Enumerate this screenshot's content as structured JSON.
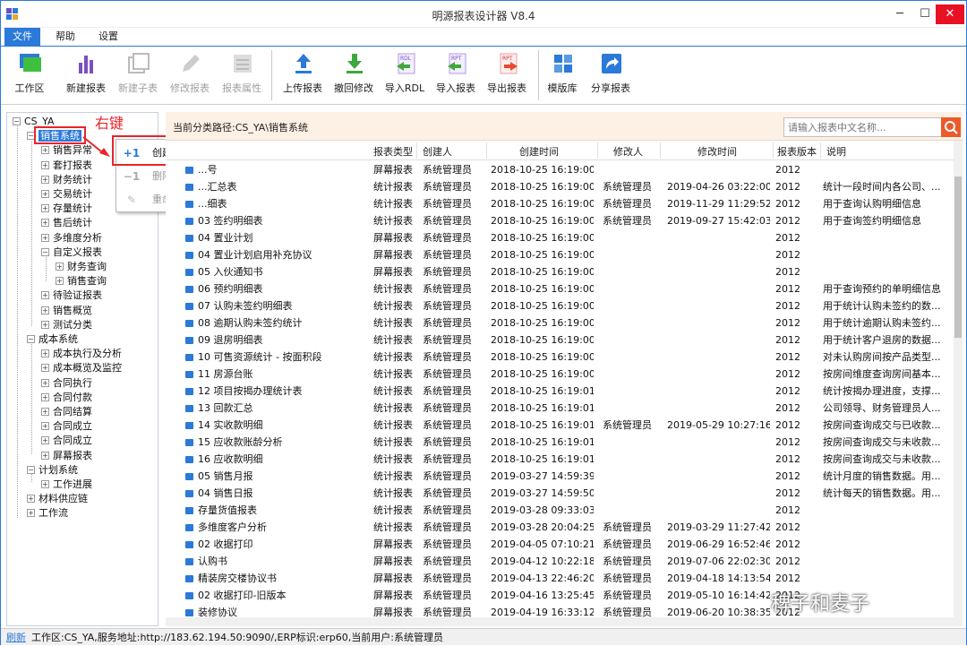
{
  "window": {
    "title": "明源报表设计器 V8.4",
    "minimize": "─",
    "maximize": "☐",
    "close": "✕"
  },
  "menu": [
    "文件",
    "帮助",
    "设置"
  ],
  "toolbar": [
    {
      "label": "工作区",
      "icon": "workspace-icon",
      "enabled": true
    },
    {
      "label": "新建报表",
      "icon": "bar-chart-icon",
      "enabled": true
    },
    {
      "label": "新建子表",
      "icon": "sub-table-icon",
      "enabled": false
    },
    {
      "label": "修改报表",
      "icon": "pencil-icon",
      "enabled": false
    },
    {
      "label": "报表属性",
      "icon": "properties-icon",
      "enabled": false
    },
    {
      "label": "上传报表",
      "icon": "upload-icon",
      "enabled": true
    },
    {
      "label": "撤回修改",
      "icon": "download-icon",
      "enabled": true
    },
    {
      "label": "导入RDL",
      "icon": "import-rdl-icon",
      "enabled": true
    },
    {
      "label": "导入报表",
      "icon": "import-rpt-icon",
      "enabled": true
    },
    {
      "label": "导出报表",
      "icon": "export-rpt-icon",
      "enabled": true
    },
    {
      "label": "模版库",
      "icon": "template-icon",
      "enabled": true
    },
    {
      "label": "分享报表",
      "icon": "share-icon",
      "enabled": true
    }
  ],
  "annotation": {
    "label": "右键"
  },
  "tree": [
    {
      "label": "CS_YA",
      "level": 0,
      "expanded": true
    },
    {
      "label": "销售系统",
      "level": 1,
      "expanded": true,
      "selected": true
    },
    {
      "label": "销售异常",
      "level": 2
    },
    {
      "label": "套打报表",
      "level": 2
    },
    {
      "label": "财务统计",
      "level": 2
    },
    {
      "label": "交易统计",
      "level": 2
    },
    {
      "label": "存量统计",
      "level": 2
    },
    {
      "label": "售后统计",
      "level": 2
    },
    {
      "label": "多维度分析",
      "level": 2
    },
    {
      "label": "自定义报表",
      "level": 2,
      "expanded": true
    },
    {
      "label": "财务查询",
      "level": 3
    },
    {
      "label": "销售查询",
      "level": 3
    },
    {
      "label": "待验证报表",
      "level": 2
    },
    {
      "label": "销售概览",
      "level": 2
    },
    {
      "label": "测试分类",
      "level": 2
    },
    {
      "label": "成本系统",
      "level": 1,
      "expanded": true
    },
    {
      "label": "成本执行及分析",
      "level": 2
    },
    {
      "label": "成本概览及监控",
      "level": 2
    },
    {
      "label": "合同执行",
      "level": 2
    },
    {
      "label": "合同付款",
      "level": 2
    },
    {
      "label": "合同结算",
      "level": 2
    },
    {
      "label": "合同成立",
      "level": 2
    },
    {
      "label": "合同成立",
      "level": 2
    },
    {
      "label": "屏幕报表",
      "level": 2
    },
    {
      "label": "计划系统",
      "level": 1,
      "expanded": true
    },
    {
      "label": "工作进展",
      "level": 2
    },
    {
      "label": "材料供应链",
      "level": 1
    },
    {
      "label": "工作流",
      "level": 1
    }
  ],
  "context_menu": [
    {
      "label": "创建分类(A)",
      "icon": "+1",
      "enabled": true
    },
    {
      "label": "删除分类(D)",
      "icon": "−1",
      "enabled": false
    },
    {
      "label": "重命名(R)",
      "icon": "✎",
      "enabled": false
    }
  ],
  "main": {
    "path": "当前分类路径:CS_YA\\销售系统",
    "search_placeholder": "请输入报表中文名称...",
    "columns": [
      "报表类型",
      "创建人",
      "创建时间",
      "修改人",
      "修改时间",
      "报表版本",
      "说明"
    ],
    "rows": [
      {
        "name": "...号",
        "type": "屏幕报表",
        "creator": "系统管理员",
        "created": "2018-10-25 16:19:00",
        "modifier": "",
        "modified": "",
        "version": "2012",
        "desc": ""
      },
      {
        "name": "...汇总表",
        "type": "统计报表",
        "creator": "系统管理员",
        "created": "2018-10-25 16:19:00",
        "modifier": "系统管理员",
        "modified": "2019-04-26 03:22:00",
        "version": "2012",
        "desc": "统计一段时间内各公司、..."
      },
      {
        "name": "...细表",
        "type": "统计报表",
        "creator": "系统管理员",
        "created": "2018-10-25 16:19:00",
        "modifier": "系统管理员",
        "modified": "2019-11-29 11:29:52",
        "version": "2012",
        "desc": "用于查询认购明细信息"
      },
      {
        "name": "03 签约明细表",
        "type": "统计报表",
        "creator": "系统管理员",
        "created": "2018-10-25 16:19:00",
        "modifier": "系统管理员",
        "modified": "2019-09-27 15:42:03",
        "version": "2012",
        "desc": "用于查询签约明细信息"
      },
      {
        "name": "04 置业计划",
        "type": "屏幕报表",
        "creator": "系统管理员",
        "created": "2018-10-25 16:19:00",
        "modifier": "",
        "modified": "",
        "version": "2012",
        "desc": ""
      },
      {
        "name": "04 置业计划启用补充协议",
        "type": "屏幕报表",
        "creator": "系统管理员",
        "created": "2018-10-25 16:19:00",
        "modifier": "",
        "modified": "",
        "version": "2012",
        "desc": ""
      },
      {
        "name": "05 入伙通知书",
        "type": "屏幕报表",
        "creator": "系统管理员",
        "created": "2018-10-25 16:19:00",
        "modifier": "",
        "modified": "",
        "version": "2012",
        "desc": ""
      },
      {
        "name": "06 预约明细表",
        "type": "统计报表",
        "creator": "系统管理员",
        "created": "2018-10-25 16:19:00",
        "modifier": "",
        "modified": "",
        "version": "2012",
        "desc": "用于查询预约的单明细信息"
      },
      {
        "name": "07 认购未签约明细表",
        "type": "统计报表",
        "creator": "系统管理员",
        "created": "2018-10-25 16:19:00",
        "modifier": "",
        "modified": "",
        "version": "2012",
        "desc": "用于统计认购未签约的数..."
      },
      {
        "name": "08 逾期认购未签约统计",
        "type": "统计报表",
        "creator": "系统管理员",
        "created": "2018-10-25 16:19:00",
        "modifier": "",
        "modified": "",
        "version": "2012",
        "desc": "用于统计逾期认购未签约..."
      },
      {
        "name": "09 退房明细表",
        "type": "统计报表",
        "creator": "系统管理员",
        "created": "2018-10-25 16:19:00",
        "modifier": "",
        "modified": "",
        "version": "2012",
        "desc": "用于统计客户退房的数据..."
      },
      {
        "name": "10 可售资源统计 - 按面积段",
        "type": "统计报表",
        "creator": "系统管理员",
        "created": "2018-10-25 16:19:00",
        "modifier": "",
        "modified": "",
        "version": "2012",
        "desc": "对未认购房间按产品类型..."
      },
      {
        "name": "11 房源台账",
        "type": "统计报表",
        "creator": "系统管理员",
        "created": "2018-10-25 16:19:00",
        "modifier": "",
        "modified": "",
        "version": "2012",
        "desc": "按房间维度查询房间基本..."
      },
      {
        "name": "12 项目按揭办理统计表",
        "type": "统计报表",
        "creator": "系统管理员",
        "created": "2018-10-25 16:19:01",
        "modifier": "",
        "modified": "",
        "version": "2012",
        "desc": "统计按揭办理进度，支撑..."
      },
      {
        "name": "13 回款汇总",
        "type": "统计报表",
        "creator": "系统管理员",
        "created": "2018-10-25 16:19:01",
        "modifier": "",
        "modified": "",
        "version": "2012",
        "desc": "公司领导、财务管理员人..."
      },
      {
        "name": "14 实收款明细",
        "type": "统计报表",
        "creator": "系统管理员",
        "created": "2018-10-25 16:19:01",
        "modifier": "系统管理员",
        "modified": "2019-05-29 10:27:16",
        "version": "2012",
        "desc": "按房间查询成交与已收款..."
      },
      {
        "name": "15 应收款账龄分析",
        "type": "统计报表",
        "creator": "系统管理员",
        "created": "2018-10-25 16:19:01",
        "modifier": "",
        "modified": "",
        "version": "2012",
        "desc": "按房间查询成交与未收款..."
      },
      {
        "name": "16 应收款明细",
        "type": "统计报表",
        "creator": "系统管理员",
        "created": "2018-10-25 16:19:01",
        "modifier": "",
        "modified": "",
        "version": "2012",
        "desc": "按房间查询成交与未收款..."
      },
      {
        "name": "05 销售月报",
        "type": "统计报表",
        "creator": "系统管理员",
        "created": "2019-03-27 14:59:39",
        "modifier": "",
        "modified": "",
        "version": "2012",
        "desc": "统计月度的销售数据。用..."
      },
      {
        "name": "04 销售日报",
        "type": "统计报表",
        "creator": "系统管理员",
        "created": "2019-03-27 14:59:50",
        "modifier": "",
        "modified": "",
        "version": "2012",
        "desc": "统计每天的销售数据。用..."
      },
      {
        "name": "存量货值报表",
        "type": "统计报表",
        "creator": "系统管理员",
        "created": "2019-03-28 09:33:03",
        "modifier": "",
        "modified": "",
        "version": "2012",
        "desc": ""
      },
      {
        "name": "多维度客户分析",
        "type": "统计报表",
        "creator": "系统管理员",
        "created": "2019-03-28 20:04:25",
        "modifier": "系统管理员",
        "modified": "2019-03-29 11:27:42",
        "version": "2012",
        "desc": ""
      },
      {
        "name": "02 收据打印",
        "type": "屏幕报表",
        "creator": "系统管理员",
        "created": "2019-04-05 07:10:21",
        "modifier": "系统管理员",
        "modified": "2019-06-29 16:52:46",
        "version": "2012",
        "desc": ""
      },
      {
        "name": "认购书",
        "type": "屏幕报表",
        "creator": "系统管理员",
        "created": "2019-04-12 10:22:18",
        "modifier": "系统管理员",
        "modified": "2019-07-06 22:02:30",
        "version": "2012",
        "desc": ""
      },
      {
        "name": "精装房交楼协议书",
        "type": "屏幕报表",
        "creator": "系统管理员",
        "created": "2019-04-13 22:46:20",
        "modifier": "系统管理员",
        "modified": "2019-04-18 14:13:54",
        "version": "2012",
        "desc": ""
      },
      {
        "name": "02 收据打印-旧版本",
        "type": "屏幕报表",
        "creator": "系统管理员",
        "created": "2019-04-16 13:25:45",
        "modifier": "系统管理员",
        "modified": "2019-05-10 16:14:42",
        "version": "2012",
        "desc": ""
      },
      {
        "name": "装修协议",
        "type": "屏幕报表",
        "creator": "系统管理员",
        "created": "2019-04-19 16:33:12",
        "modifier": "系统管理员",
        "modified": "2019-06-20 10:38:35",
        "version": "2012",
        "desc": ""
      }
    ]
  },
  "status": {
    "refresh": "刷新",
    "text": "工作区:CS_YA,服务地址:http://183.62.194.50:9090/,ERP标识:erp60,当前用户:系统管理员"
  },
  "watermark": "稗子和麦子",
  "colors": {
    "accent": "#2b79d8",
    "annotation": "#e8242b",
    "path_bar": "#fdf1e6",
    "search_button": "#ec5b2b"
  }
}
